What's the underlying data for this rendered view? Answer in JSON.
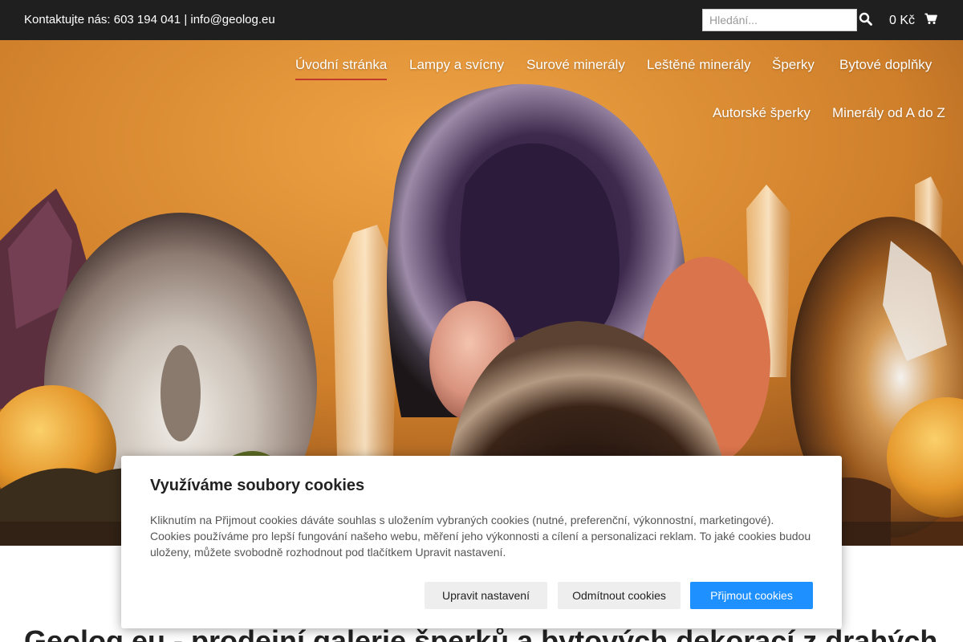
{
  "topbar": {
    "contact": "Kontaktujte nás: 603 194 041 | info@geolog.eu",
    "search_placeholder": "Hledání...",
    "search_icon": "search-icon",
    "cart_total": "0 Kč",
    "cart_icon": "cart-icon"
  },
  "nav": {
    "items": [
      "Úvodní stránka",
      "Lampy a svícny",
      "Surové minerály",
      "Leštěné minerály",
      "Šperky",
      "Bytové doplňky",
      "Autorské šperky",
      "Minerály od A do Z"
    ],
    "active_index": 0,
    "active_color": "#c0392b"
  },
  "main": {
    "heading": "Geolog.eu - prodejní galerie šperků a bytových dekorací z drahých"
  },
  "cookies": {
    "title": "Využíváme soubory cookies",
    "text": "Kliknutím na Přijmout cookies dáváte souhlas s uložením vybraných cookies (nutné, preferenční, výkonnostní, marketingové). Cookies používáme pro lepší fungování našeho webu, měření jeho výkonnosti a cílení a personalizaci reklam. To jaké cookies budou uloženy, můžete svobodně rozhodnout pod tlačítkem Upravit nastavení.",
    "btn_settings": "Upravit nastavení",
    "btn_reject": "Odmítnout cookies",
    "btn_accept": "Přijmout cookies",
    "accent_color": "#1e90ff"
  }
}
